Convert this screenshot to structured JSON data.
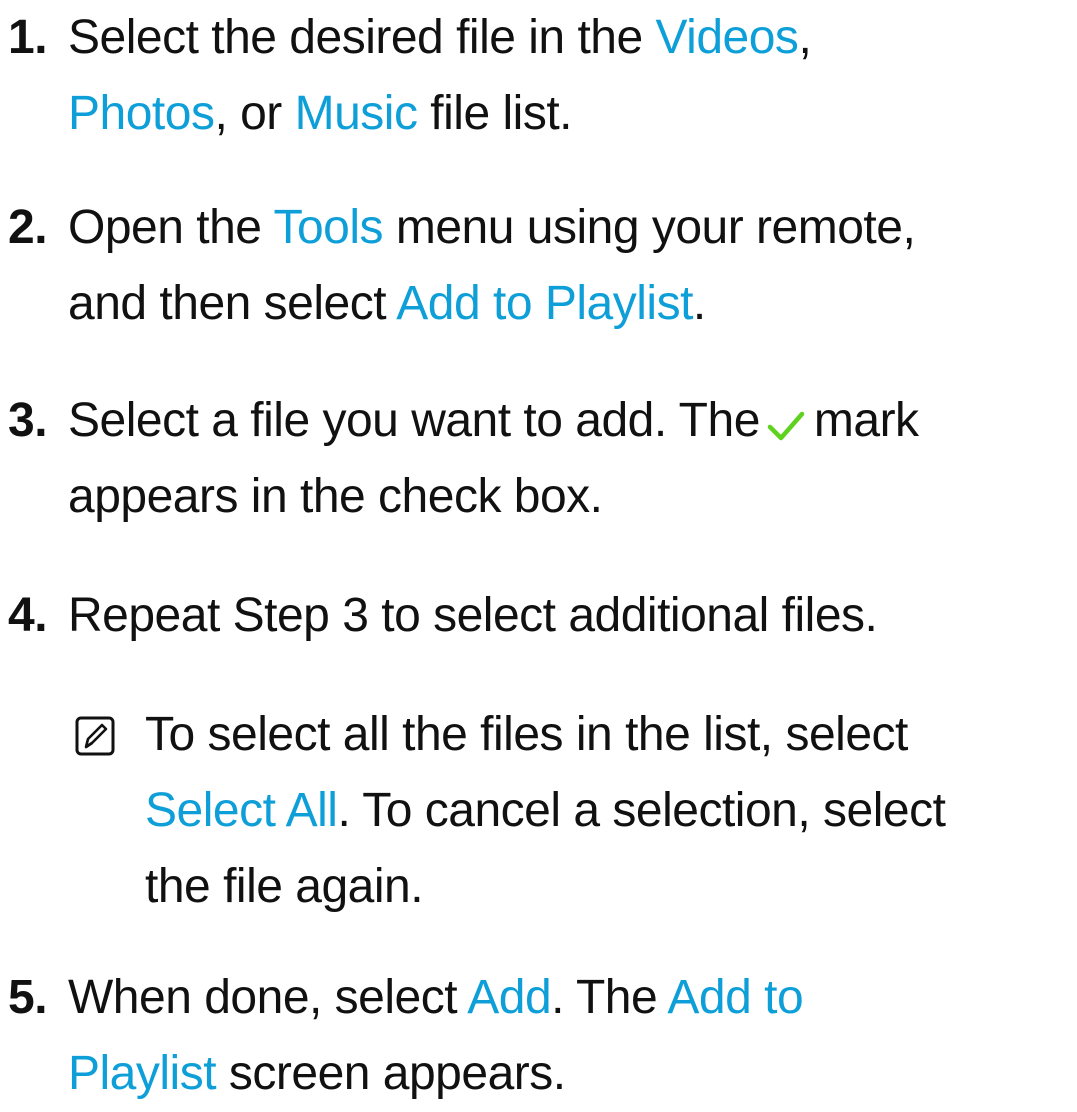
{
  "steps": [
    {
      "number": "1.",
      "line1": {
        "t1": "Select the desired file in the ",
        "h1": "Videos",
        "t2": ","
      },
      "line2": {
        "h1": "Photos",
        "t1": ", or ",
        "h2": "Music",
        "t2": " file list."
      }
    },
    {
      "number": "2.",
      "line1": {
        "t1": "Open the ",
        "h1": "Tools",
        "t2": " menu using your remote,"
      },
      "line2": {
        "t1": "and then select ",
        "h1": "Add to Playlist",
        "t2": "."
      }
    },
    {
      "number": "3.",
      "line1": {
        "t1": "Select a file you want to add. The",
        "t2": "mark"
      },
      "line2": {
        "t1": "appears in the check box."
      }
    },
    {
      "number": "4.",
      "line1": {
        "t1": "Repeat Step 3 to select additional files."
      }
    },
    {
      "number": "5.",
      "line1": {
        "t1": "When done, select ",
        "h1": "Add",
        "t2": ". The ",
        "h2": "Add to"
      },
      "line2": {
        "h1": "Playlist",
        "t1": " screen appears."
      }
    }
  ],
  "note": {
    "icon": "note-icon",
    "line1": {
      "t1": "To select all the files in the list, select"
    },
    "line2": {
      "h1": "Select All",
      "t1": ". To cancel a selection, select"
    },
    "line3": {
      "t1": "the file again."
    }
  },
  "colors": {
    "highlight": "#0e9fd8",
    "check": "#5fd21e",
    "text": "#111111"
  },
  "icons": [
    "checkmark-icon",
    "note-icon"
  ]
}
